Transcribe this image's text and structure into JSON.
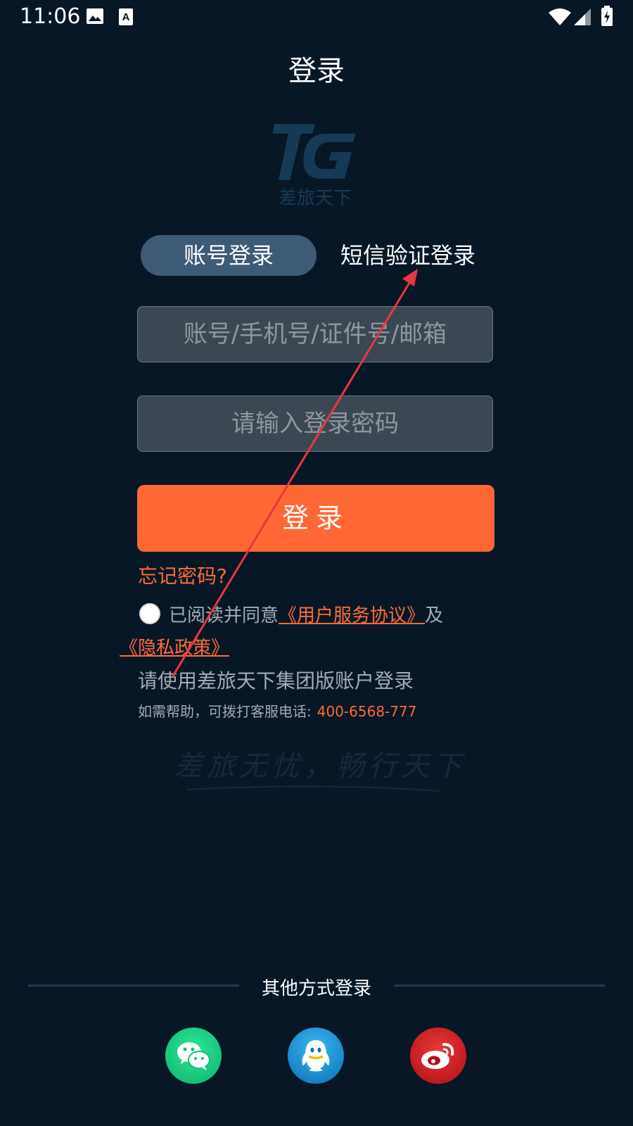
{
  "status_bar": {
    "time": "11:06",
    "icons": [
      "image-icon",
      "a-icon",
      "wifi-icon",
      "signal-icon",
      "battery-charging-icon"
    ]
  },
  "header": {
    "title": "登录"
  },
  "logo": {
    "brand_text": "差旅天下",
    "mark": "TG"
  },
  "tabs": [
    {
      "label": "账号登录",
      "active": true
    },
    {
      "label": "短信验证登录",
      "active": false
    }
  ],
  "form": {
    "account_placeholder": "账号/手机号/证件号/邮箱",
    "password_placeholder": "请输入登录密码",
    "login_label": "登录",
    "forgot_label": "忘记密码?"
  },
  "agreement": {
    "prefix": "已阅读并同意",
    "user_agreement": "《用户服务协议》",
    "conjunction": "及",
    "privacy_policy": "《隐私政策》"
  },
  "notes": {
    "group_note": "请使用差旅天下集团版账户登录",
    "help_prefix": "如需帮助，可拨打客服电话:",
    "help_phone": "400-6568-777"
  },
  "slogan": "差旅无忧，畅行天下",
  "other_login": {
    "label": "其他方式登录",
    "providers": [
      "wechat-icon",
      "qq-icon",
      "weibo-icon"
    ]
  },
  "colors": {
    "background": "#071726",
    "accent": "#ff6835",
    "tab_active": "#3d5a76",
    "annotation": "#e8373f"
  }
}
